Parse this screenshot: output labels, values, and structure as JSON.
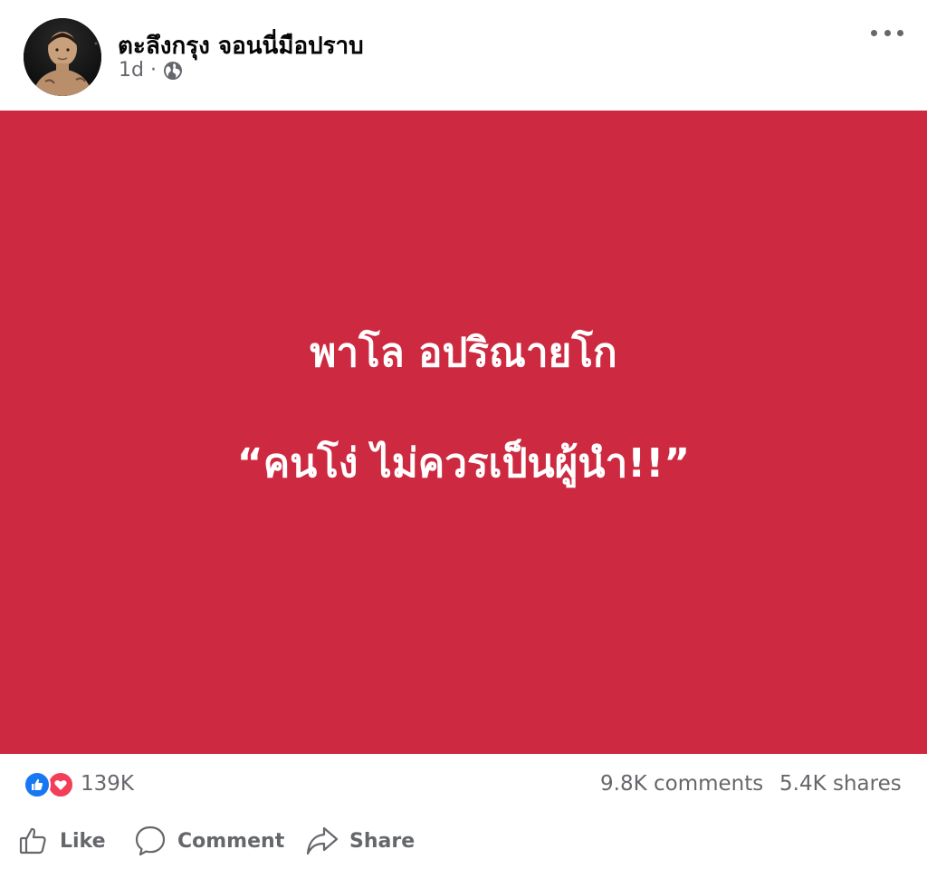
{
  "post": {
    "author": "ตะลึงกรุง จอนนี่มือปราบ",
    "time": "1d",
    "audience_icon": "globe-icon",
    "content": {
      "line1": "พาโล อปริณายโก",
      "line2": "“คนโง่ ไม่ควรเป็นผู้นำ!!”",
      "background_color": "#cd2a41"
    },
    "stats": {
      "reaction_types": [
        "like",
        "love"
      ],
      "reactions": "139K",
      "comments": "9.8K comments",
      "shares": "5.4K shares"
    },
    "actions": {
      "like": "Like",
      "comment": "Comment",
      "share": "Share"
    }
  }
}
